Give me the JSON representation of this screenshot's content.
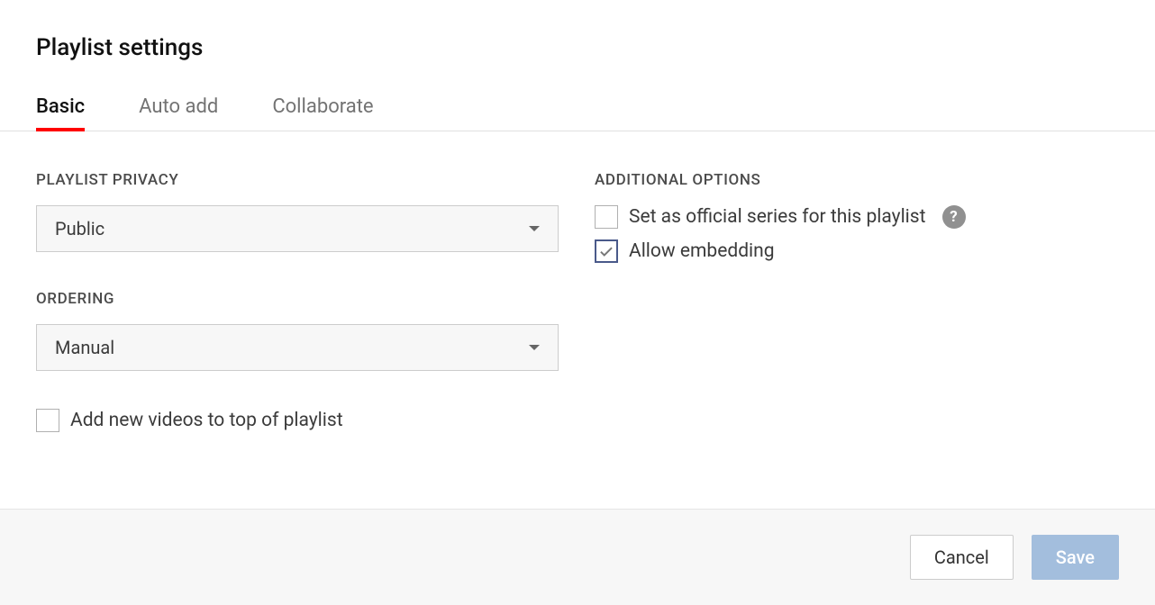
{
  "title": "Playlist settings",
  "tabs": {
    "basic": "Basic",
    "auto_add": "Auto add",
    "collaborate": "Collaborate"
  },
  "left": {
    "privacy_label": "PLAYLIST PRIVACY",
    "privacy_value": "Public",
    "ordering_label": "ORDERING",
    "ordering_value": "Manual",
    "add_top_label": "Add new videos to top of playlist"
  },
  "right": {
    "additional_label": "ADDITIONAL OPTIONS",
    "official_series_label": "Set as official series for this playlist",
    "allow_embedding_label": "Allow embedding"
  },
  "footer": {
    "cancel": "Cancel",
    "save": "Save"
  }
}
